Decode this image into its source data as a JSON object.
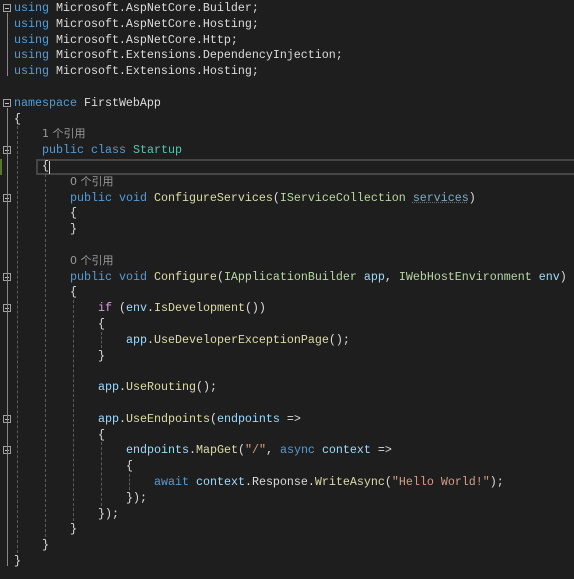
{
  "editor": {
    "colors": {
      "background": "#1e1e1e",
      "keyword": "#569cd6",
      "control": "#d8a0df",
      "type": "#4ec9b0",
      "interface": "#b8d7a3",
      "method": "#dcdcaa",
      "parameter": "#9cdcfe",
      "string": "#d69d85",
      "text": "#dcdcdc",
      "codelens": "#999999"
    },
    "current_line": 11,
    "folded_regions_icon": "collapse-minus-icon",
    "lines": [
      {
        "indent": 0,
        "fold": true,
        "tokens": [
          [
            "using",
            "kw"
          ],
          [
            " Microsoft.AspNetCore.Builder;",
            "pl"
          ]
        ]
      },
      {
        "indent": 0,
        "tokens": [
          [
            "using",
            "kw"
          ],
          [
            " Microsoft.AspNetCore.Hosting;",
            "pl"
          ]
        ]
      },
      {
        "indent": 0,
        "tokens": [
          [
            "using",
            "kw"
          ],
          [
            " Microsoft.AspNetCore.Http;",
            "pl"
          ]
        ]
      },
      {
        "indent": 0,
        "tokens": [
          [
            "using",
            "kw"
          ],
          [
            " Microsoft.Extensions.DependencyInjection;",
            "pl"
          ]
        ]
      },
      {
        "indent": 0,
        "tokens": [
          [
            "using",
            "kw"
          ],
          [
            " Microsoft.Extensions.Hosting;",
            "pl"
          ]
        ]
      },
      {
        "indent": 0,
        "tokens": []
      },
      {
        "indent": 0,
        "fold": true,
        "tokens": [
          [
            "namespace",
            "kw"
          ],
          [
            " FirstWebApp",
            "pl"
          ]
        ]
      },
      {
        "indent": 0,
        "tokens": [
          [
            "{",
            "pl"
          ]
        ]
      },
      {
        "indent": 4,
        "tokens": [
          [
            "1 个引用",
            "lens"
          ]
        ]
      },
      {
        "indent": 4,
        "fold": true,
        "tokens": [
          [
            "public",
            "kw"
          ],
          [
            " ",
            "pl"
          ],
          [
            "class",
            "kw"
          ],
          [
            " ",
            "pl"
          ],
          [
            "Startup",
            "type"
          ]
        ]
      },
      {
        "indent": 4,
        "tokens": [
          [
            "{",
            "pl"
          ]
        ]
      },
      {
        "indent": 8,
        "tokens": [
          [
            "0 个引用",
            "lens"
          ]
        ]
      },
      {
        "indent": 8,
        "fold": true,
        "tokens": [
          [
            "public",
            "kw"
          ],
          [
            " ",
            "pl"
          ],
          [
            "void",
            "kw"
          ],
          [
            " ",
            "pl"
          ],
          [
            "ConfigureServices",
            "method"
          ],
          [
            "(",
            "pl"
          ],
          [
            "IServiceCollection",
            "iface"
          ],
          [
            " ",
            "pl"
          ],
          [
            "services",
            "unused"
          ],
          [
            ")",
            "pl"
          ]
        ]
      },
      {
        "indent": 8,
        "tokens": [
          [
            "{",
            "pl"
          ]
        ]
      },
      {
        "indent": 8,
        "tokens": [
          [
            "}",
            "pl"
          ]
        ]
      },
      {
        "indent": 0,
        "tokens": []
      },
      {
        "indent": 8,
        "tokens": [
          [
            "0 个引用",
            "lens"
          ]
        ]
      },
      {
        "indent": 8,
        "fold": true,
        "tokens": [
          [
            "public",
            "kw"
          ],
          [
            " ",
            "pl"
          ],
          [
            "void",
            "kw"
          ],
          [
            " ",
            "pl"
          ],
          [
            "Configure",
            "method"
          ],
          [
            "(",
            "pl"
          ],
          [
            "IApplicationBuilder",
            "iface"
          ],
          [
            " ",
            "pl"
          ],
          [
            "app",
            "param"
          ],
          [
            ", ",
            "pl"
          ],
          [
            "IWebHostEnvironment",
            "iface"
          ],
          [
            " ",
            "pl"
          ],
          [
            "env",
            "param"
          ],
          [
            ")",
            "pl"
          ]
        ]
      },
      {
        "indent": 8,
        "tokens": [
          [
            "{",
            "pl"
          ]
        ]
      },
      {
        "indent": 12,
        "fold": true,
        "tokens": [
          [
            "if",
            "ctl"
          ],
          [
            " (",
            "pl"
          ],
          [
            "env",
            "param"
          ],
          [
            ".",
            "pl"
          ],
          [
            "IsDevelopment",
            "method"
          ],
          [
            "())",
            "pl"
          ]
        ]
      },
      {
        "indent": 12,
        "tokens": [
          [
            "{",
            "pl"
          ]
        ]
      },
      {
        "indent": 16,
        "tokens": [
          [
            "app",
            "param"
          ],
          [
            ".",
            "pl"
          ],
          [
            "UseDeveloperExceptionPage",
            "method"
          ],
          [
            "();",
            "pl"
          ]
        ]
      },
      {
        "indent": 12,
        "tokens": [
          [
            "}",
            "pl"
          ]
        ]
      },
      {
        "indent": 0,
        "tokens": []
      },
      {
        "indent": 12,
        "tokens": [
          [
            "app",
            "param"
          ],
          [
            ".",
            "pl"
          ],
          [
            "UseRouting",
            "method"
          ],
          [
            "();",
            "pl"
          ]
        ]
      },
      {
        "indent": 0,
        "tokens": []
      },
      {
        "indent": 12,
        "fold": true,
        "tokens": [
          [
            "app",
            "param"
          ],
          [
            ".",
            "pl"
          ],
          [
            "UseEndpoints",
            "method"
          ],
          [
            "(",
            "pl"
          ],
          [
            "endpoints",
            "param"
          ],
          [
            " =>",
            "pl"
          ]
        ]
      },
      {
        "indent": 12,
        "tokens": [
          [
            "{",
            "pl"
          ]
        ]
      },
      {
        "indent": 16,
        "fold": true,
        "tokens": [
          [
            "endpoints",
            "param"
          ],
          [
            ".",
            "pl"
          ],
          [
            "MapGet",
            "method"
          ],
          [
            "(",
            "pl"
          ],
          [
            "\"/\"",
            "str"
          ],
          [
            ", ",
            "pl"
          ],
          [
            "async",
            "kw"
          ],
          [
            " ",
            "pl"
          ],
          [
            "context",
            "param"
          ],
          [
            " =>",
            "pl"
          ]
        ]
      },
      {
        "indent": 16,
        "tokens": [
          [
            "{",
            "pl"
          ]
        ]
      },
      {
        "indent": 20,
        "tokens": [
          [
            "await",
            "kw"
          ],
          [
            " ",
            "pl"
          ],
          [
            "context",
            "param"
          ],
          [
            ".Response.",
            "pl"
          ],
          [
            "WriteAsync",
            "method"
          ],
          [
            "(",
            "pl"
          ],
          [
            "\"Hello World!\"",
            "str"
          ],
          [
            ");",
            "pl"
          ]
        ]
      },
      {
        "indent": 16,
        "tokens": [
          [
            "});",
            "pl"
          ]
        ]
      },
      {
        "indent": 12,
        "tokens": [
          [
            "});",
            "pl"
          ]
        ]
      },
      {
        "indent": 8,
        "tokens": [
          [
            "}",
            "pl"
          ]
        ]
      },
      {
        "indent": 4,
        "tokens": [
          [
            "}",
            "pl"
          ]
        ]
      },
      {
        "indent": 0,
        "tokens": [
          [
            "}",
            "pl"
          ]
        ]
      }
    ]
  }
}
